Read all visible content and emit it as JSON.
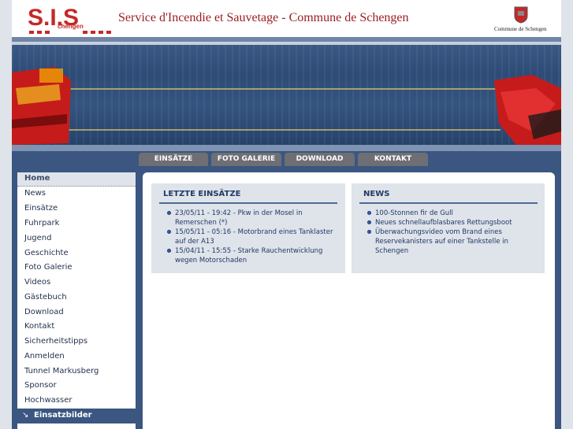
{
  "header": {
    "logo_letters": "S.I.S",
    "logo_subtext": "chengen",
    "title": "Service d'Incendie et Sauvetage - Commune de Schengen",
    "crest_label": "Commune de Schengen"
  },
  "nav": {
    "tabs": [
      "EINSÄTZE",
      "FOTO GALERIE",
      "DOWNLOAD",
      "KONTAKT"
    ]
  },
  "sidebar": {
    "home": "Home",
    "items": [
      "News",
      "Einsätze",
      "Fuhrpark",
      "Jugend",
      "Geschichte",
      "Foto Galerie",
      "Videos",
      "Gästebuch",
      "Download",
      "Kontakt",
      "Sicherheitstipps",
      "Anmelden",
      "Tunnel Markusberg",
      "Sponsor",
      "Hochwasser"
    ],
    "active": "Einsatzbilder"
  },
  "einsaetze": {
    "title": "LETZTE EINSÄTZE",
    "items": [
      "23/05/11 - 19:42 - Pkw in der Mosel in Remerschen (*)",
      "15/05/11 - 05:16 - Motorbrand eines Tanklaster auf der A13",
      "15/04/11 - 15:55 - Starke Rauchentwicklung wegen Motorschaden"
    ]
  },
  "news": {
    "title": "NEWS",
    "items": [
      "100-Stonnen fir de Gull",
      "Neues schnellaufblasbares Rettungsboot",
      "Überwachungsvideo vom Brand eines Reservekanisters auf einer Tankstelle in Schengen"
    ]
  },
  "colors": {
    "brand_red": "#c62828",
    "title_red": "#9c1f24",
    "nav_blue": "#3b5680",
    "box_bg": "#dfe3ea",
    "tab_gray": "#6d6f74"
  }
}
